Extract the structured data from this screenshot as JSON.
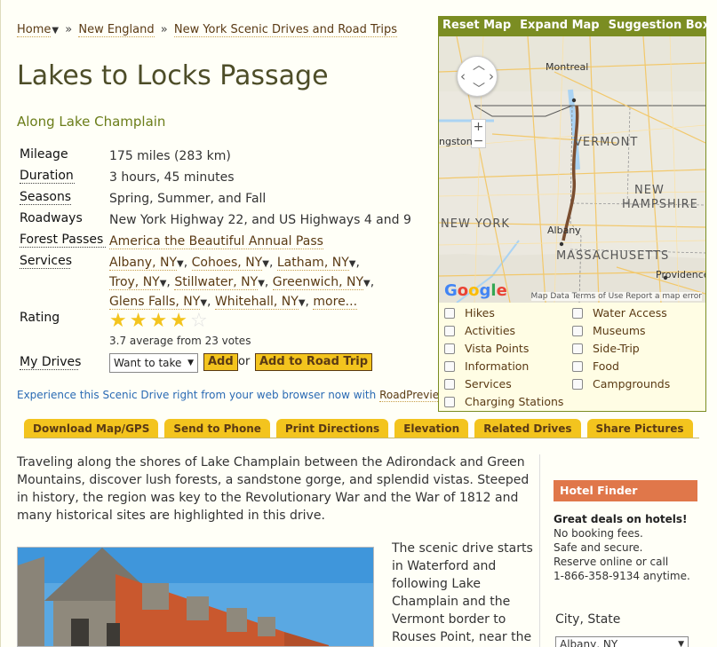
{
  "breadcrumb": {
    "home": "Home",
    "caret": "▼",
    "sep": "»",
    "region": "New England",
    "current": "New York Scenic Drives and Road Trips"
  },
  "title": "Lakes to Locks Passage",
  "subtitle": "Along Lake Champlain",
  "facts": {
    "mileage_label": "Mileage",
    "mileage": "175 miles (283 km)",
    "duration_label": "Duration",
    "duration": "3 hours, 45 minutes",
    "seasons_label": "Seasons",
    "seasons": "Spring, Summer, and Fall",
    "roadways_label": "Roadways",
    "roadways": "New York Highway 22, and US Highways 4 and 9",
    "passes_label": "Forest Passes",
    "passes": "America the Beautiful Annual Pass",
    "services_label": "Services",
    "services": [
      "Albany, NY",
      "Cohoes, NY",
      "Latham, NY",
      "Troy, NY",
      "Stillwater, NY",
      "Greenwich, NY",
      "Glens Falls, NY",
      "Whitehall, NY"
    ],
    "more": "more...",
    "rating_label": "Rating",
    "rating_value": 3.7,
    "rating_max": 5,
    "votes_text": "3.7 average from 23 votes",
    "mydrives_label": "My Drives",
    "mydrives_select": "Want to take",
    "add_label": "Add",
    "or_label": "or",
    "add_trip_label": "Add to Road Trip"
  },
  "experience": {
    "text": "Experience this Scenic Drive right from your web browser now with ",
    "link": "RoadPreview",
    "end": "."
  },
  "map": {
    "buttons": [
      "Reset Map",
      "Expand Map",
      "Suggestion Box"
    ],
    "labels": {
      "montreal": "Montreal",
      "livingston": "ngston",
      "vermont": "VERMONT",
      "new_hampshire_1": "NEW",
      "new_hampshire_2": "HAMPSHIRE",
      "new_york": "NEW YORK",
      "albany": "Albany",
      "massachusetts": "MASSACHUSETTS",
      "providence": "Providence"
    },
    "zoom_in": "+",
    "zoom_out": "−",
    "google": "Google",
    "footer": "Map Data  Terms of Use  Report a map error"
  },
  "layers_left": [
    "Hikes",
    "Activities",
    "Vista Points",
    "Information",
    "Services",
    "Charging Stations"
  ],
  "layers_right": [
    "Water Access",
    "Museums",
    "Side-Trip",
    "Food",
    "Campgrounds"
  ],
  "tabs": [
    "Download Map/GPS",
    "Send to Phone",
    "Print Directions",
    "Elevation",
    "Related Drives",
    "Share Pictures"
  ],
  "intro": "Traveling along the shores of Lake Champlain between the Adirondack and Green Mountains, discover lush forests, a sandstone gorge, and splendid vistas. Steeped in history, the region was key to the Revolutionary War and the War of 1812 and many historical sites are highlighted in this drive.",
  "side_text": "The scenic drive starts in Waterford and following Lake Champlain and the Vermont border to Rouses Point, near the",
  "hotel": {
    "heading": "Hotel Finder",
    "deals": "Great deals on hotels!",
    "line1": "No booking fees.",
    "line2": "Safe and secure.",
    "line3": "Reserve online or call",
    "line4": "1-866-358-9134 anytime.",
    "city_label": "City, State",
    "city_value": "Albany, NY"
  },
  "colors": {
    "accent_green": "#7b8d22",
    "tab_yellow": "#f3c41e",
    "link_brown": "#5a3a14",
    "hotel_orange": "#e0774a"
  }
}
